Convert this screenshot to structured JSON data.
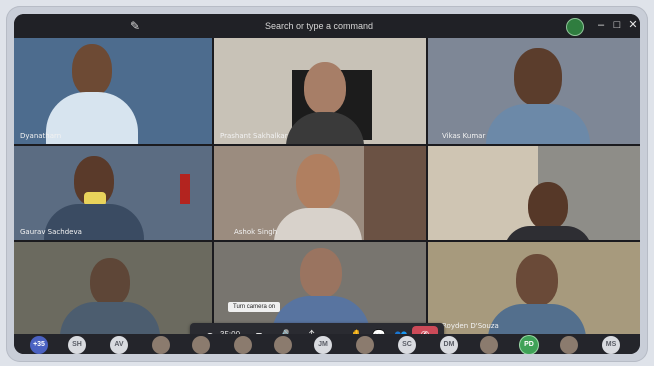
{
  "titlebar": {
    "search_placeholder": "Search or type a command",
    "new_chat_icon": "compose-icon",
    "window_controls": [
      "minimize-icon",
      "maximize-icon",
      "close-icon"
    ]
  },
  "tiles": [
    {
      "label": "Dyanatharn",
      "bg": "#4d6c8e"
    },
    {
      "label": "Prashant Sakhalkar",
      "bg": "#c8c2b7"
    },
    {
      "label": "Vikas Kumar",
      "bg": "#7e8796"
    },
    {
      "label": "Gaurav Sachdeva",
      "bg": "#5b6c82"
    },
    {
      "label": "Ashok Singh",
      "bg": "#9b8c7f"
    },
    {
      "label": "",
      "bg": "#8e8d88"
    },
    {
      "label": "",
      "bg": "#6b6a5f"
    },
    {
      "label": "",
      "bg": "#78756f"
    },
    {
      "label": "Royden D'Souza",
      "bg": "#a79a7d"
    }
  ],
  "call_controls": {
    "timer": "35:00",
    "tooltip": "Turn camera on",
    "icons": [
      "record-icon",
      "camera-icon",
      "mic-icon",
      "share-screen-icon",
      "more-icon",
      "raise-hand-icon",
      "chat-icon",
      "participants-icon",
      "hang-up-icon"
    ]
  },
  "roster": [
    "+35",
    "SH",
    "AV",
    "",
    "",
    "",
    "",
    "JM",
    "",
    "SC",
    "DM",
    "",
    "PD",
    "",
    "MS"
  ],
  "colors": {
    "leave": "#cc4a58",
    "accent_green": "#3fa257"
  }
}
